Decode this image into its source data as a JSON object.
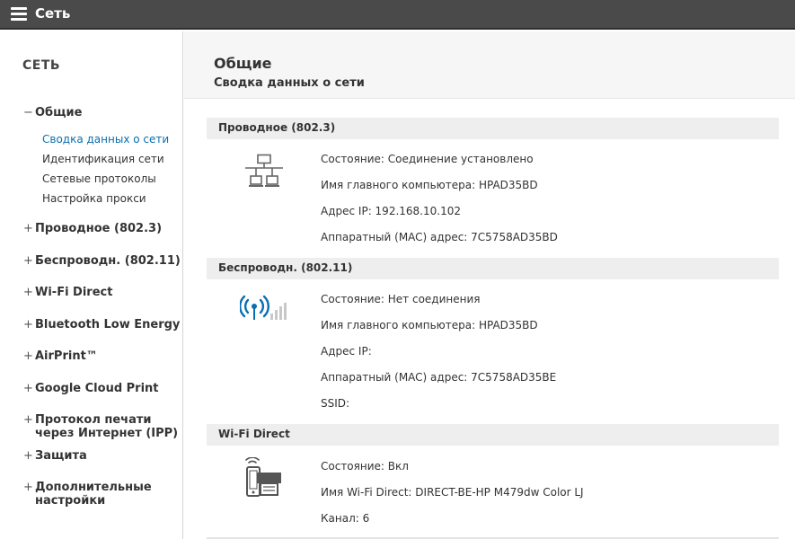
{
  "topbar": {
    "title": "Сеть"
  },
  "sidebar": {
    "title": "СЕТЬ",
    "groups": {
      "general": {
        "sign": "−",
        "label": "Общие"
      },
      "wired": {
        "sign": "+",
        "label": "Проводное (802.3)"
      },
      "wireless": {
        "sign": "+",
        "label": "Беспроводн. (802.11)"
      },
      "wifi_direct": {
        "sign": "+",
        "label": "Wi-Fi Direct"
      },
      "ble": {
        "sign": "+",
        "label": "Bluetooth Low Energy"
      },
      "airprint": {
        "sign": "+",
        "label": "AirPrint™"
      },
      "cloud": {
        "sign": "+",
        "label": "Google Cloud Print"
      },
      "ipp": {
        "sign": "+",
        "line1": "Протокол печати",
        "line2": "через Интернет (IPP)"
      },
      "security": {
        "sign": "+",
        "label": "Защита"
      },
      "advanced": {
        "sign": "+",
        "line1": "Дополнительные",
        "line2": "настройки"
      }
    },
    "general_items": [
      "Сводка данных о сети",
      "Идентификация сети",
      "Сетевые протоколы",
      "Настройка прокси"
    ]
  },
  "main": {
    "title": "Общие",
    "subtitle": "Сводка данных о сети",
    "wired": {
      "header": "Проводное (802.3)",
      "status": "Состояние: Соединение установлено",
      "host": "Имя главного компьютера: HPAD35BD",
      "ip": "Адрес IP: 192.168.10.102",
      "mac": "Аппаратный (MAC) адрес: 7C5758AD35BD",
      "icon": "wired-network-icon"
    },
    "wireless": {
      "header": "Беспроводн. (802.11)",
      "status": "Состояние: Нет соединения",
      "host": "Имя главного компьютера: HPAD35BD",
      "ip": "Адрес IP:",
      "mac": "Аппаратный (MAC) адрес: 7C5758AD35BE",
      "ssid": "SSID:",
      "icon": "wireless-signal-icon"
    },
    "wifi_direct": {
      "header": "Wi-Fi Direct",
      "status": "Состояние: Вкл",
      "name": "Имя Wi-Fi Direct: DIRECT-BE-HP M479dw Color LJ",
      "channel": "Канал: 6",
      "icon": "wifi-direct-icon"
    }
  },
  "colors": {
    "topbar": "#4a4a4a",
    "active_link": "#0a6fb0",
    "wireless_icon": "#0a6fb0",
    "section_bg": "#eeeeee"
  }
}
